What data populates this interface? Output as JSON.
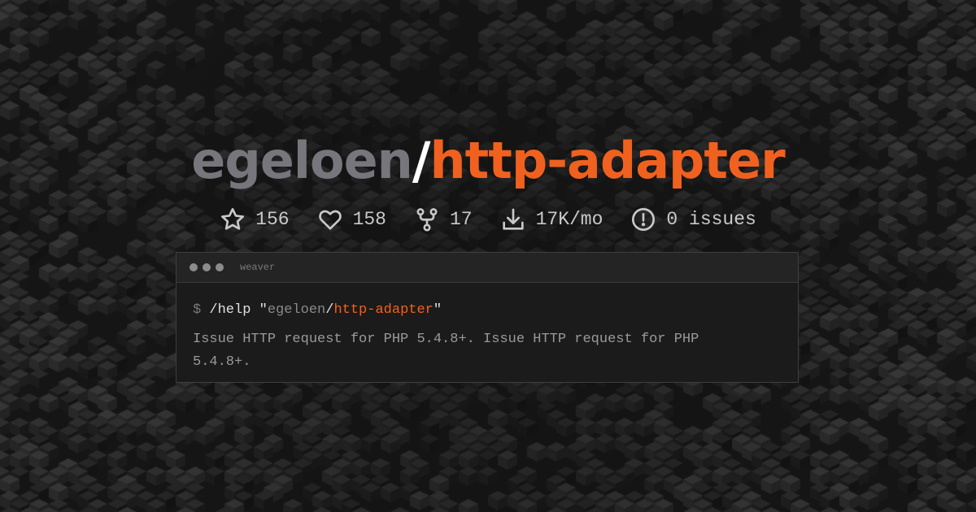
{
  "repo": {
    "owner": "egeloen",
    "separator": "/",
    "name": "http-adapter"
  },
  "stats": [
    {
      "icon": "star-icon",
      "value": "156"
    },
    {
      "icon": "heart-icon",
      "value": "158"
    },
    {
      "icon": "fork-icon",
      "value": "17"
    },
    {
      "icon": "download-icon",
      "value": "17K/mo"
    },
    {
      "icon": "issue-icon",
      "value": "0 issues"
    }
  ],
  "terminal": {
    "title": "weaver",
    "prompt": "$",
    "command": "/help",
    "quote_open": "\"",
    "arg_owner": "egeloen",
    "arg_separator": "/",
    "arg_repo": "http-adapter",
    "quote_close": "\"",
    "description": "Issue HTTP request for PHP 5.4.8+. Issue HTTP request for PHP 5.4.8+."
  },
  "colors": {
    "accent": "#f0611f",
    "owner": "#77767c",
    "background": "#161616"
  }
}
